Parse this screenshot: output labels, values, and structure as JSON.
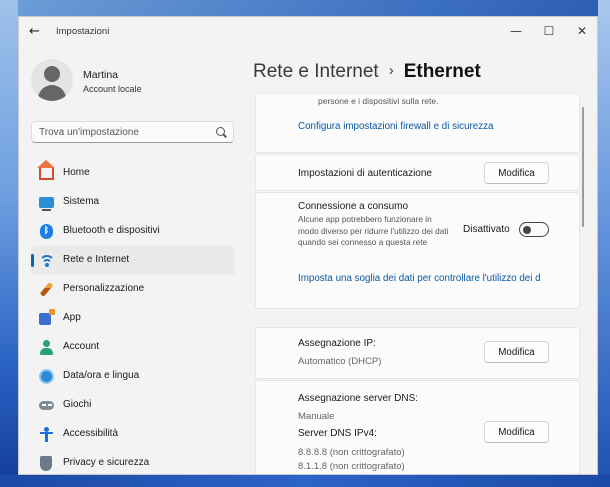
{
  "app": {
    "title": "Impostazioni"
  },
  "profile": {
    "name": "Martina",
    "account_type": "Account locale"
  },
  "search": {
    "placeholder": "Trova un'impostazione"
  },
  "sidebar": {
    "items": [
      {
        "label": "Home",
        "icon": "home-icon"
      },
      {
        "label": "Sistema",
        "icon": "system-icon"
      },
      {
        "label": "Bluetooth e dispositivi",
        "icon": "bluetooth-icon"
      },
      {
        "label": "Rete e Internet",
        "icon": "wifi-icon",
        "active": true
      },
      {
        "label": "Personalizzazione",
        "icon": "brush-icon"
      },
      {
        "label": "App",
        "icon": "apps-icon"
      },
      {
        "label": "Account",
        "icon": "account-icon"
      },
      {
        "label": "Data/ora e lingua",
        "icon": "time-language-icon"
      },
      {
        "label": "Giochi",
        "icon": "gamepad-icon"
      },
      {
        "label": "Accessibilità",
        "icon": "accessibility-icon"
      },
      {
        "label": "Privacy e sicurezza",
        "icon": "shield-icon"
      }
    ]
  },
  "breadcrumb": {
    "parent": "Rete e Internet",
    "separator": "›",
    "current": "Ethernet"
  },
  "main": {
    "firewall_desc": "persone e i dispositivi sulla rete.",
    "firewall_link": "Configura impostazioni firewall e di sicurezza",
    "auth": {
      "label": "Impostazioni di autenticazione",
      "button": "Modifica"
    },
    "metered": {
      "label": "Connessione a consumo",
      "desc": "Alcune app potrebbero funzionare in modo diverso per ridurre l'utilizzo dei dati quando sei connesso a questa rete",
      "state": "Disattivato",
      "link": "Imposta una soglia dei dati per controllare l'utilizzo dei d"
    },
    "ip": {
      "label": "Assegnazione IP:",
      "value": "Automatico (DHCP)",
      "button": "Modifica"
    },
    "dns": {
      "label": "Assegnazione server DNS:",
      "mode": "Manuale",
      "ipv4_label": "Server DNS IPv4:",
      "server1": "8.8.8.8 (non crittografato)",
      "server2": "8.1.1.8 (non crittografato)",
      "button": "Modifica"
    }
  },
  "colors": {
    "accent": "#0067c0",
    "link": "#0a57a5"
  }
}
